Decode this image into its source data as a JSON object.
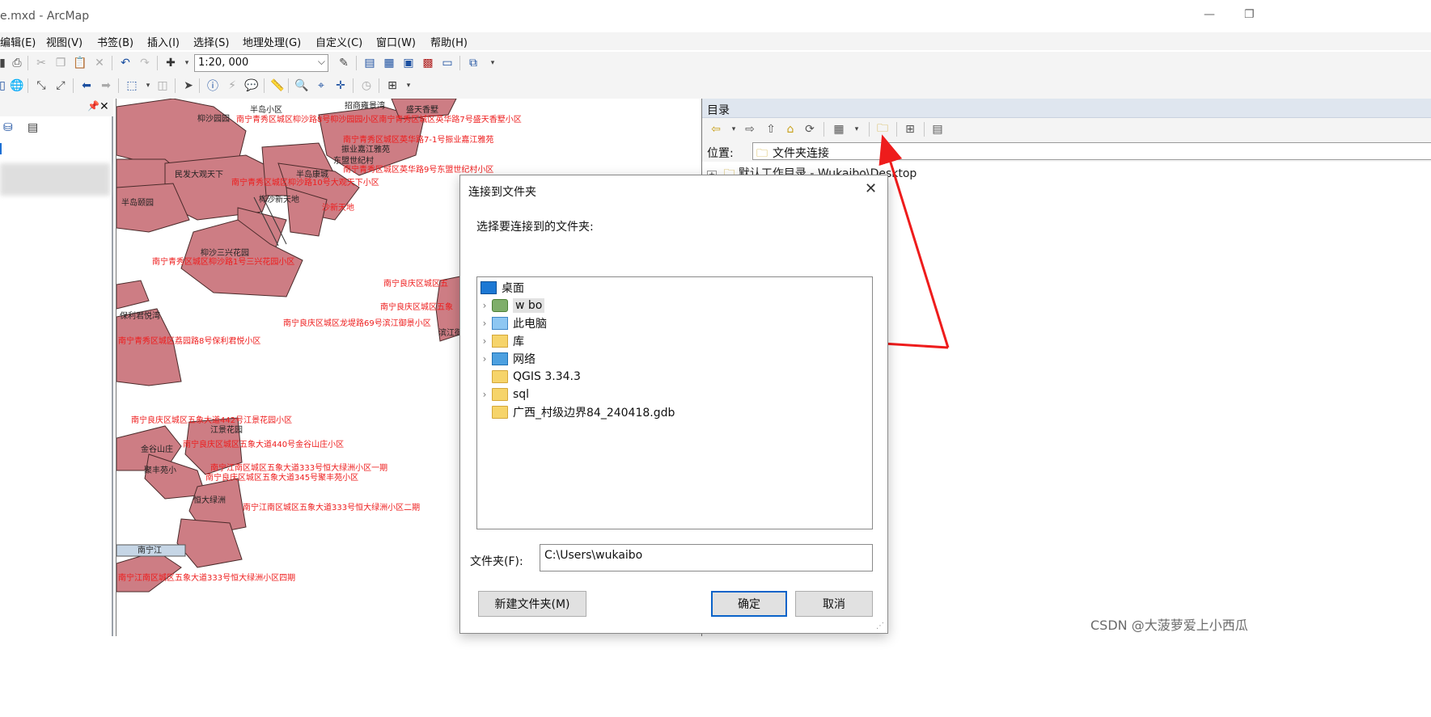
{
  "window": {
    "title": "e.mxd - ArcMap",
    "minimize": "—",
    "restore": "❐"
  },
  "menu": [
    "编辑(E)",
    "视图(V)",
    "书签(B)",
    "插入(I)",
    "选择(S)",
    "地理处理(G)",
    "自定义(C)",
    "窗口(W)",
    "帮助(H)"
  ],
  "toolbar": {
    "scale_value": "1:20, 000"
  },
  "toc": {
    "pin": "ᵖ",
    "close": "✕"
  },
  "map_labels": {
    "red": [
      "南宁青秀区城区枊沙路8号枊沙园园小区南宁青秀区城区英华路7号盛天香墅小区",
      "南宁青秀区城区英华路7-1号振业嘉江雅苑",
      "南宁青秀区城区英华路9号东盟世纪村小区",
      "南宁青秀区城区枊沙路10号大观天下小区",
      "沙新天地",
      "南宁青秀区城区枊沙路1号三兴花园小区",
      "南宁良庆区城区五",
      "南宁良庆区城区五象",
      "南宁良庆区城区龙堤路69号滨江御景小区",
      "南宁青秀区城区荔园路8号保利君悦小区",
      "南宁良庆区城区五象大道442号江景花园小区",
      "南宁良庆区城区五象大道440号金谷山庄小区",
      "南宁江南区城区五象大道333号恒大绿洲小区一期",
      "南宁良庆区城区五象大道345号聚丰苑小区",
      "南宁江南区城区五象大道333号恒大绿洲小区二期",
      "南宁江南区城区五象大道333号恒大绿洲小区四期"
    ],
    "black": [
      "半岛小区",
      "招商雍景湾",
      "盛天香墅",
      "枊沙园园",
      "民发大观天下",
      "半岛康城",
      "振业嘉江雅苑",
      "东盟世纪村",
      "半岛颐园",
      "枊沙新天地",
      "枊沙三兴花园",
      "保利君悦湾",
      "江景花园",
      "金谷山庄",
      "聚丰苑小",
      "恒大绿洲",
      "滨江御",
      "南宁江"
    ]
  },
  "catalog": {
    "title": "目录",
    "location_label": "位置:",
    "location_value": "文件夹连接",
    "tree_item": "默认工作目录 - Wukaibo\\Desktop"
  },
  "dialog": {
    "title": "连接到文件夹",
    "close": "✕",
    "prompt": "选择要连接到的文件夹:",
    "tree": [
      {
        "label": "桌面",
        "icon": "desktop-icon",
        "expandable": false,
        "indent": 0
      },
      {
        "label": "w    bo",
        "icon": "user-icon",
        "expandable": true,
        "indent": 1
      },
      {
        "label": "此电脑",
        "icon": "computer-icon",
        "expandable": true,
        "indent": 1
      },
      {
        "label": "库",
        "icon": "library-icon",
        "expandable": true,
        "indent": 1
      },
      {
        "label": "网络",
        "icon": "network-icon",
        "expandable": true,
        "indent": 1
      },
      {
        "label": "QGIS 3.34.3",
        "icon": "folder-icon",
        "expandable": false,
        "indent": 1
      },
      {
        "label": "sql",
        "icon": "folder-icon",
        "expandable": true,
        "indent": 1
      },
      {
        "label": "广西_村级边界84_240418.gdb",
        "icon": "folder-icon",
        "expandable": false,
        "indent": 1
      }
    ],
    "folder_label": "文件夹(F):",
    "folder_value": "C:\\Users\\wukaibo",
    "new_folder": "新建文件夹(M)",
    "ok": "确定",
    "cancel": "取消"
  },
  "watermark": "CSDN @大菠萝爱上小西瓜",
  "colors": {
    "parcel_fill": "#cd7d84",
    "label_red": "#ee1c1c",
    "arrow_red": "#ee1c1c",
    "catalog_header": "#dfe6ef"
  }
}
